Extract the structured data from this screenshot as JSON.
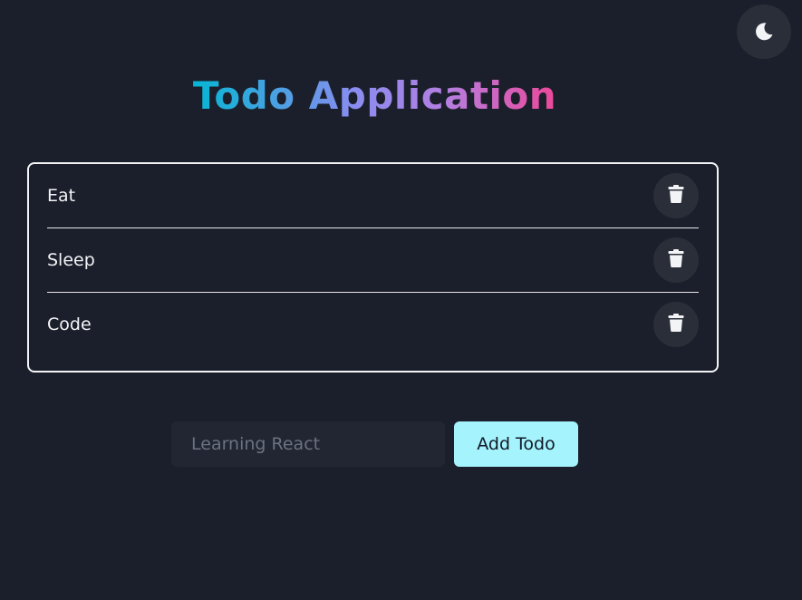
{
  "theme_toggle": {
    "icon": "moon-icon"
  },
  "header": {
    "title": "Todo Application"
  },
  "todos": [
    {
      "text": "Eat",
      "icon": "trash-icon"
    },
    {
      "text": "Sleep",
      "icon": "trash-icon"
    },
    {
      "text": "Code",
      "icon": "trash-icon"
    }
  ],
  "form": {
    "placeholder": "Learning React",
    "value": "",
    "add_label": "Add Todo"
  },
  "colors": {
    "background": "#1b1f2b",
    "button_bg": "#2a2e39",
    "accent": "#a5f3fc",
    "title_gradient": [
      "#06b6d4",
      "#8b8cf0",
      "#ec4899"
    ]
  }
}
